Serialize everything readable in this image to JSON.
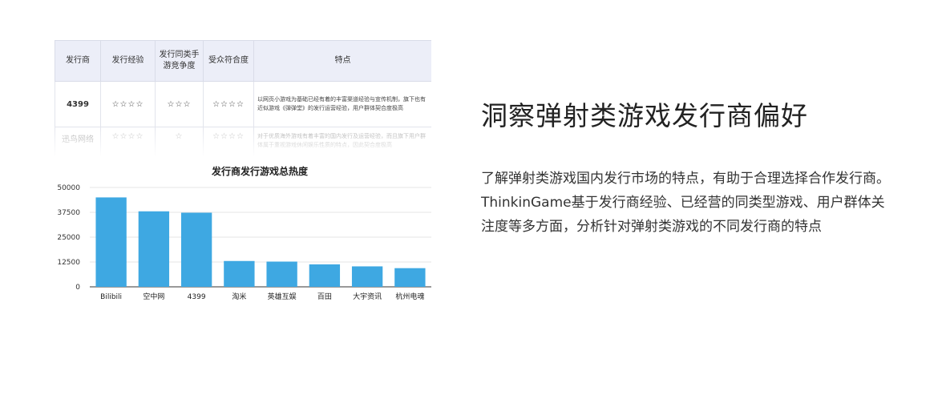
{
  "table": {
    "headers": [
      "发行商",
      "发行经验",
      "发行同类手游竞争度",
      "受众符合度",
      "特点"
    ],
    "rows": [
      {
        "name": "4399",
        "experience": "☆☆☆☆",
        "competition": "☆☆☆",
        "audience": "☆☆☆☆",
        "feature": "以网页小游戏为基础已经有着的丰富渠道经验与宣传机制，旗下也有近似游戏《弹弹堂》的发行运营经验，用户群体契合度极高"
      },
      {
        "name": "迅鸟网络",
        "experience": "☆☆☆☆",
        "competition": "☆",
        "audience": "☆☆☆☆",
        "feature": "对于优质海外游戏有着丰富的国内发行及运营经验，而且旗下用户群体属于重视游戏休闲娱乐性质的特点，因此契合度极高"
      }
    ]
  },
  "chart_data": {
    "type": "bar",
    "title": "发行商发行游戏总热度",
    "categories": [
      "Bilibili",
      "空中网",
      "4399",
      "淘米",
      "英雄互娱",
      "百田",
      "大宇资讯",
      "杭州电魂"
    ],
    "values": [
      45000,
      38000,
      37300,
      13000,
      12700,
      11300,
      10300,
      9400
    ],
    "ylim": [
      0,
      50000
    ],
    "yticks": [
      "50000",
      "37500",
      "25000",
      "12500",
      "0"
    ],
    "xlabel": "",
    "ylabel": "",
    "grid": true,
    "bar_color": "#3ea8e2"
  },
  "heading": "洞察弹射类游戏发行商偏好",
  "description": "了解弹射类游戏国内发行市场的特点，有助于合理选择合作发行商。ThinkinGame基于发行商经验、已经营的同类型游戏、用户群体关注度等多方面，分析针对弹射类游戏的不同发行商的特点"
}
